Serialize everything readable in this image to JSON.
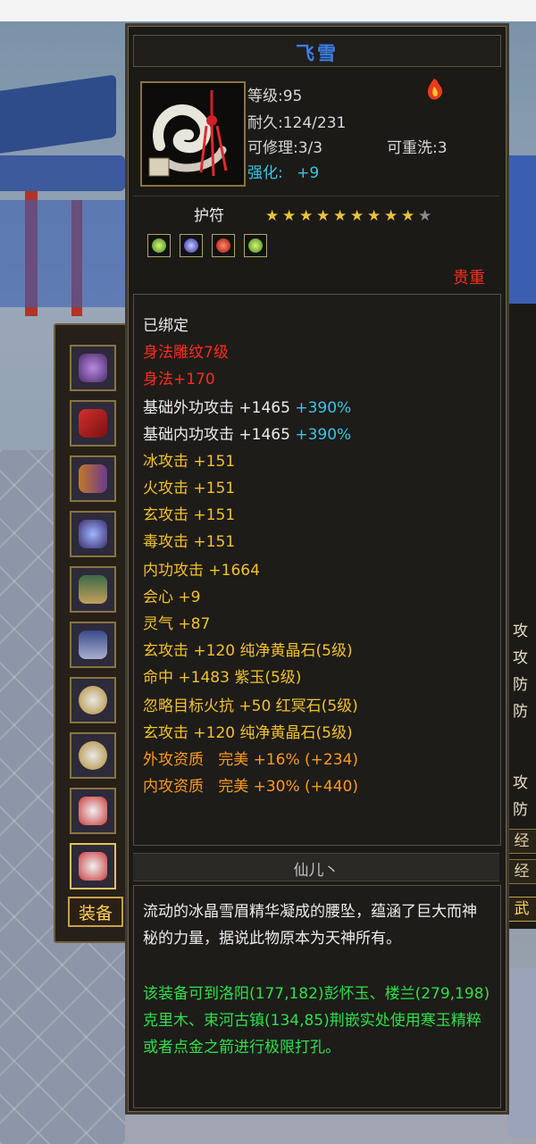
{
  "tooltip": {
    "name": "飞雪",
    "level": "等级:95",
    "durability": "耐久:124/231",
    "repairable": "可修理:3/3",
    "rewashable": "可重洗:3",
    "enhance_label": "强化:",
    "enhance_value": "+9",
    "category": "护符",
    "star_rating": {
      "filled": 9,
      "total": 10
    },
    "rarity": "贵重",
    "gem_slots": [
      "green-gem-icon",
      "blue-gem-icon",
      "red-gem-icon",
      "green-gem-icon"
    ],
    "bound": "已绑定",
    "engraving": "身法雕纹7级",
    "engraving_bonus": "身法+170",
    "attributes": [
      {
        "text": "基础外功攻击 +1465 ",
        "extra": "+390%"
      },
      {
        "text": "基础内功攻击 +1465 ",
        "extra": "+390%"
      },
      {
        "text": "冰攻击 +151"
      },
      {
        "text": "火攻击 +151"
      },
      {
        "text": "玄攻击 +151"
      },
      {
        "text": "毒攻击 +151"
      },
      {
        "text": "内功攻击 +1664"
      },
      {
        "text": "会心 +9"
      },
      {
        "text": "灵气 +87"
      }
    ],
    "gems": [
      "玄攻击 +120 纯净黄晶石(5级)",
      "命中 +1483 紫玉(5级)",
      "忽略目标火抗 +50 红冥石(5级)",
      "玄攻击 +120 纯净黄晶石(5级)"
    ],
    "qualities": [
      "外攻资质   完美 +16% (+234)",
      "内攻资质   完美 +30% (+440)"
    ],
    "crafter": "仙儿丶",
    "description": "流动的冰晶雪眉精华凝成的腰坠，蕴涵了巨大而神秘的力量，据说此物原本为天神所有。",
    "hint": "该装备可到洛阳(177,182)彭怀玉、楼兰(279,198)克里木、束河古镇(134,85)荆嵌实处使用寒玉精粹或者点金之箭进行极限打孔。"
  },
  "equipment_panel": {
    "tab_label": "装备",
    "slots": [
      "necklace-icon",
      "scroll-icon",
      "bracer-icon",
      "gloves-icon",
      "hat-icon",
      "boots-icon",
      "ring-icon",
      "ring-icon",
      "amulet-icon",
      "amulet-icon"
    ]
  },
  "right_panel": {
    "labels": [
      "攻",
      "攻",
      "防",
      "防",
      "攻",
      "防"
    ],
    "button_exp_1": "经",
    "button_exp_2": "经",
    "button_martial": "武"
  },
  "colors": {
    "title": "#3b7fe8",
    "enhance": "#39c6e6",
    "rarity": "#ff2b1f",
    "attribute": "#f2c12e",
    "percent": "#39c6e6",
    "quality": "#ff9a1f",
    "hint": "#2fe04a"
  }
}
